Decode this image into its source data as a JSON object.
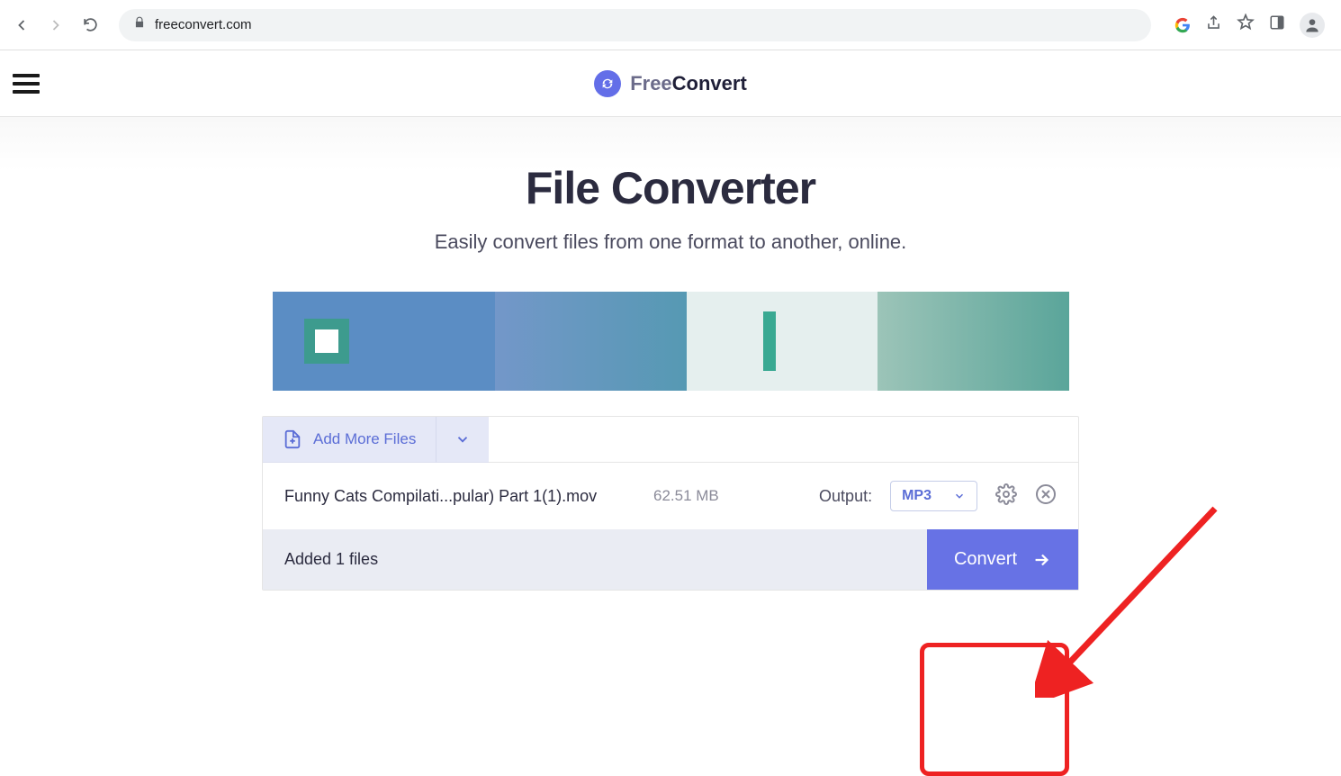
{
  "browser": {
    "url": "freeconvert.com"
  },
  "logo": {
    "part1": "Free",
    "part2": "Convert"
  },
  "hero": {
    "title": "File Converter",
    "subtitle": "Easily convert files from one format to another, online."
  },
  "panel": {
    "add_label": "Add More Files",
    "file": {
      "name": "Funny Cats Compilati...pular) Part 1(1).mov",
      "size": "62.51 MB",
      "output_label": "Output:",
      "format": "MP3"
    },
    "summary": "Added 1 files",
    "convert_label": "Convert"
  }
}
